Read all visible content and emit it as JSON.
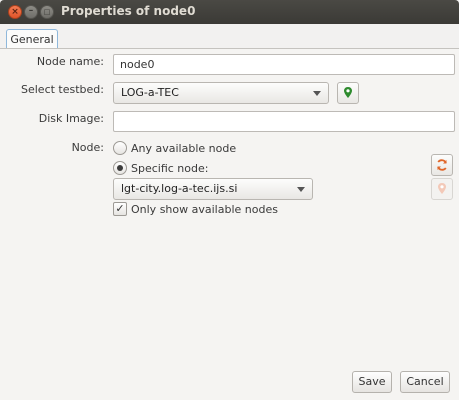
{
  "window": {
    "title": "Properties of node0",
    "controls": {
      "close": "×",
      "minimize": "–",
      "maximize": "□"
    }
  },
  "tabs": [
    {
      "label": "General",
      "selected": true
    }
  ],
  "form": {
    "node_name": {
      "label": "Node name:",
      "value": "node0"
    },
    "testbed": {
      "label": "Select testbed:",
      "value": "LOG-a-TEC",
      "icon": "map-pin-icon"
    },
    "disk_image": {
      "label": "Disk Image:",
      "value": ""
    },
    "node": {
      "label": "Node:",
      "any_label": "Any available node",
      "specific_label": "Specific node:",
      "selected_option": "specific",
      "specific_value": "lgt-city.log-a-tec.ijs.si",
      "refresh_icon": "refresh-icon",
      "location_icon": "map-pin-icon",
      "only_available_label": "Only show available nodes",
      "only_available_checked": true
    }
  },
  "footer": {
    "save_label": "Save",
    "cancel_label": "Cancel"
  },
  "colors": {
    "accent_green": "#2e8b2e",
    "refresh_orange": "#e0662a",
    "tab_border": "#8fb8db"
  }
}
